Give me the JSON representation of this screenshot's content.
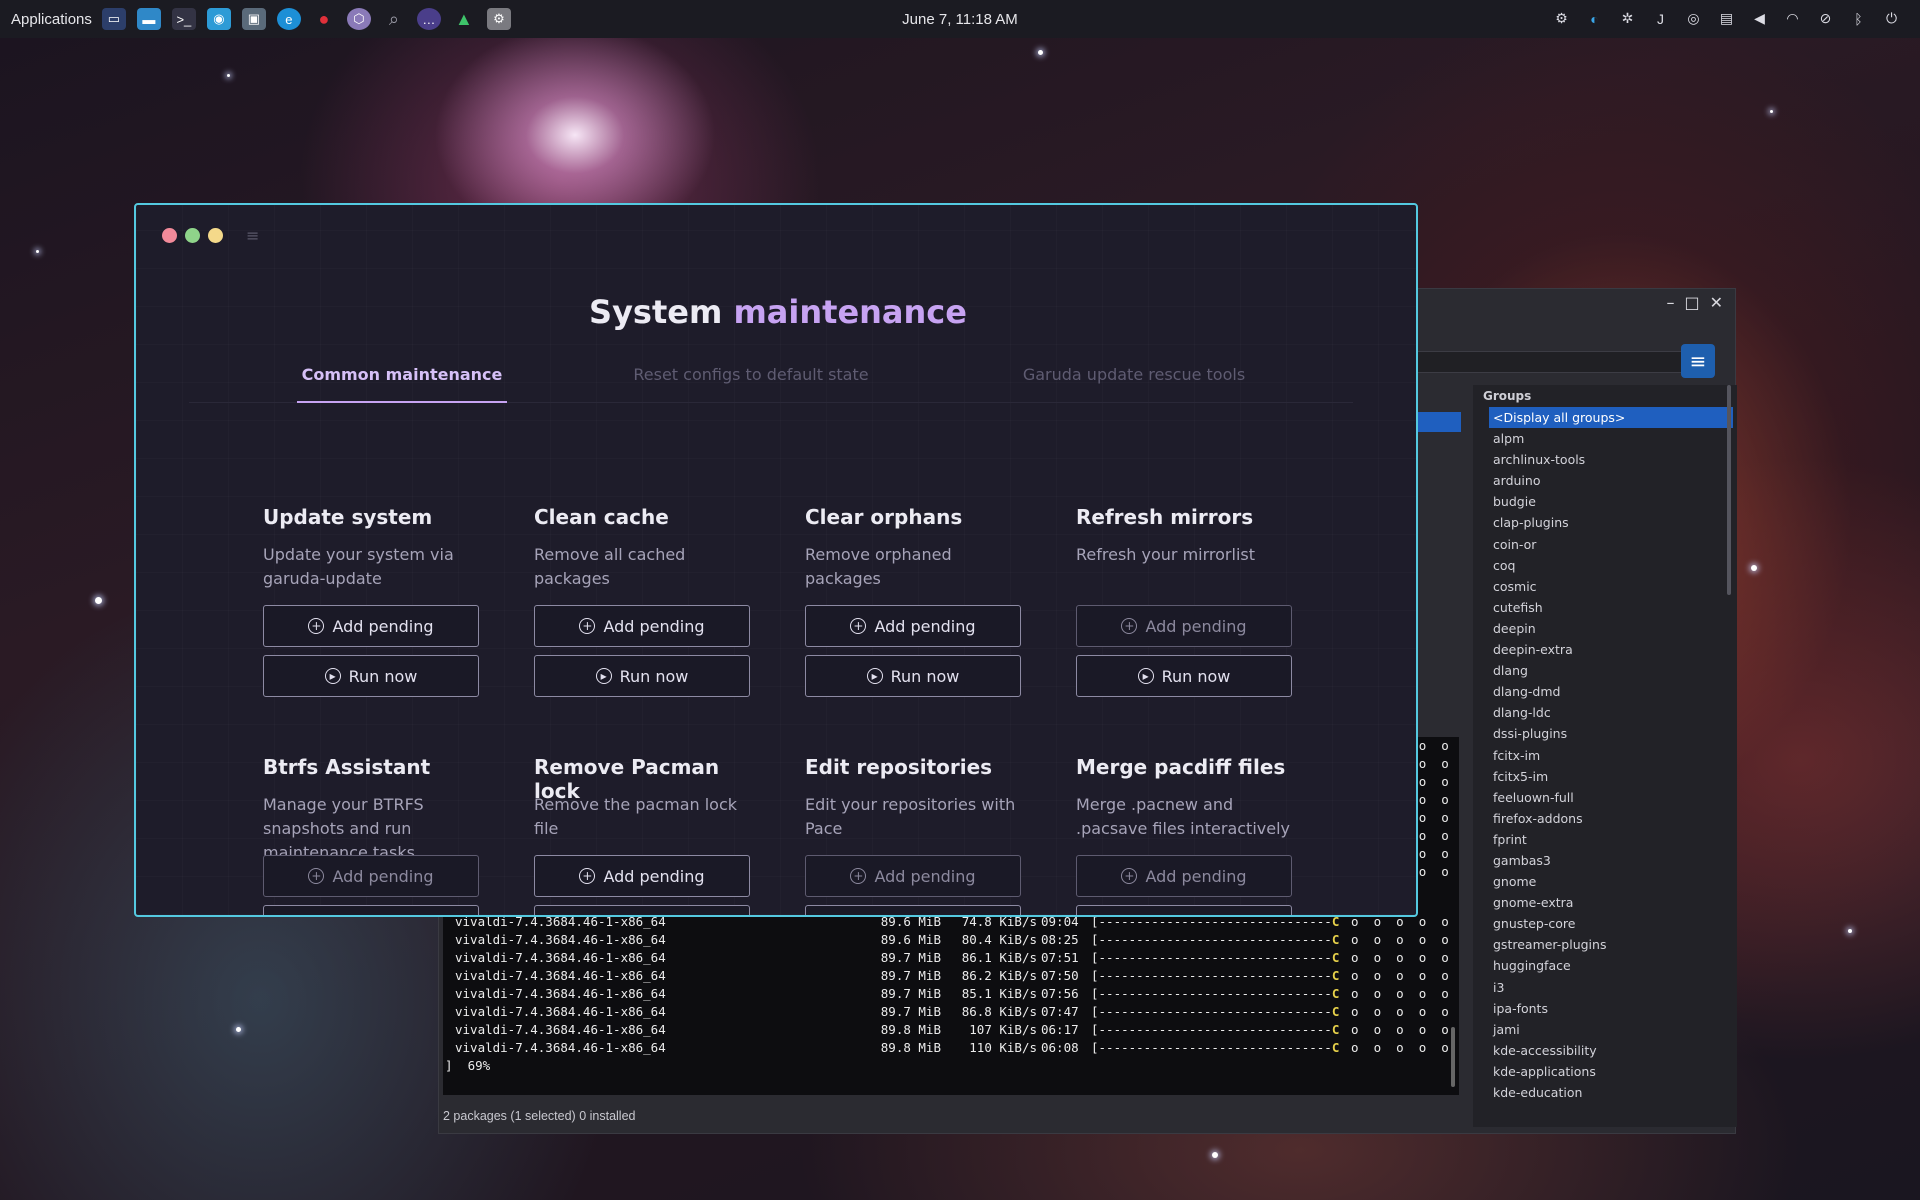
{
  "panel": {
    "applications_label": "Applications",
    "clock": "June 7, 11:18 AM",
    "launchers": [
      "terminal-icon",
      "files-icon",
      "console-icon",
      "screenshot-icon",
      "image-viewer-icon",
      "edge-browser-icon",
      "cherry-icon",
      "garuda-icon",
      "search-icon",
      "chat-icon",
      "ghost-icon",
      "settings-icon"
    ],
    "tray": [
      "gear-icon",
      "edge-icon",
      "network-tool-icon",
      "java-icon",
      "disk-icon",
      "clipboard-icon",
      "volume-icon",
      "wifi-icon",
      "notification-off-icon",
      "bluetooth-icon",
      "power-icon"
    ]
  },
  "garuda": {
    "title_main": "System ",
    "title_accent": "maintenance",
    "accent_color": "#c7a3f2",
    "border_color": "#54c9e0",
    "tabs": [
      {
        "label": "Common maintenance",
        "active": true
      },
      {
        "label": "Reset configs to default state",
        "active": false
      },
      {
        "label": "Garuda update rescue tools",
        "active": false
      }
    ],
    "cards": [
      {
        "title": "Update system",
        "desc": "Update your system via garuda-update",
        "add": "Add pending",
        "run": "Run now"
      },
      {
        "title": "Clean cache",
        "desc": "Remove all cached packages",
        "add": "Add pending",
        "run": "Run now"
      },
      {
        "title": "Clear orphans",
        "desc": "Remove orphaned packages",
        "add": "Add pending",
        "run": "Run now"
      },
      {
        "title": "Refresh mirrors",
        "desc": "Refresh your mirrorlist",
        "add": "Add pending",
        "run": "Run now"
      },
      {
        "title": "Btrfs Assistant",
        "desc": "Manage your BTRFS snapshots and run maintenance tasks",
        "add": "Add pending"
      },
      {
        "title": "Remove Pacman lock",
        "desc": "Remove the pacman lock file",
        "add": "Add pending"
      },
      {
        "title": "Edit repositories",
        "desc": "Edit your repositories with Pace",
        "add": "Add pending"
      },
      {
        "title": "Merge pacdiff files",
        "desc": "Merge .pacnew and .pacsave files interactively",
        "add": "Add pending"
      }
    ]
  },
  "pamac": {
    "groups_header": "Groups",
    "groups": [
      "<Display all groups>",
      "alpm",
      "archlinux-tools",
      "arduino",
      "budgie",
      "clap-plugins",
      "coin-or",
      "coq",
      "cosmic",
      "cutefish",
      "deepin",
      "deepin-extra",
      "dlang",
      "dlang-dmd",
      "dlang-ldc",
      "dssi-plugins",
      "fcitx-im",
      "fcitx5-im",
      "feeluown-full",
      "firefox-addons",
      "fprint",
      "gambas3",
      "gnome",
      "gnome-extra",
      "gnustep-core",
      "gstreamer-plugins",
      "huggingface",
      "i3",
      "ipa-fonts",
      "jami",
      "kde-accessibility",
      "kde-applications",
      "kde-education"
    ],
    "terminal_lines": [
      {
        "name": "vivaldi-7.4.3684.46-1-x86_64",
        "size": "89.6 MiB",
        "speed": "74.8 KiB/s",
        "time": "09:04"
      },
      {
        "name": "vivaldi-7.4.3684.46-1-x86_64",
        "size": "89.6 MiB",
        "speed": "80.4 KiB/s",
        "time": "08:25"
      },
      {
        "name": "vivaldi-7.4.3684.46-1-x86_64",
        "size": "89.7 MiB",
        "speed": "86.1 KiB/s",
        "time": "07:51"
      },
      {
        "name": "vivaldi-7.4.3684.46-1-x86_64",
        "size": "89.7 MiB",
        "speed": "86.2 KiB/s",
        "time": "07:50"
      },
      {
        "name": "vivaldi-7.4.3684.46-1-x86_64",
        "size": "89.7 MiB",
        "speed": "85.1 KiB/s",
        "time": "07:56"
      },
      {
        "name": "vivaldi-7.4.3684.46-1-x86_64",
        "size": "89.7 MiB",
        "speed": "86.8 KiB/s",
        "time": "07:47"
      },
      {
        "name": "vivaldi-7.4.3684.46-1-x86_64",
        "size": "89.8 MiB",
        "speed": "107 KiB/s",
        "time": "06:17"
      },
      {
        "name": "vivaldi-7.4.3684.46-1-x86_64",
        "size": "89.8 MiB",
        "speed": "110 KiB/s",
        "time": "06:08"
      }
    ],
    "progress_bar": "[-------------------------------C",
    "progress_dots": "o  o  o  o  o",
    "progress_text": "]  69%",
    "status": "2 packages (1 selected)   0 installed"
  }
}
